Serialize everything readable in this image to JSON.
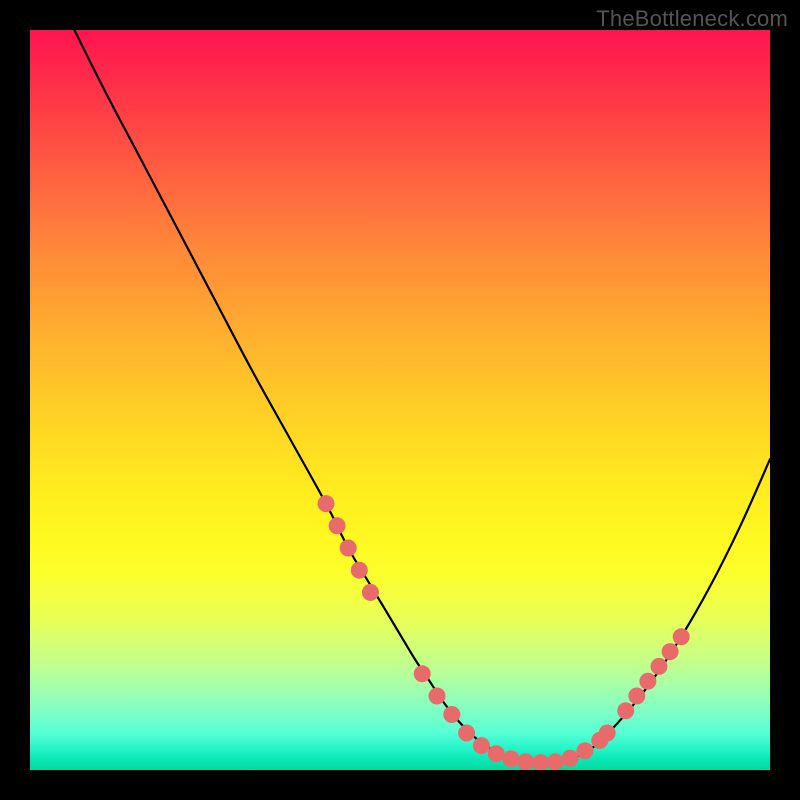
{
  "watermark": "TheBottleneck.com",
  "chart_data": {
    "type": "line",
    "title": "",
    "xlabel": "",
    "ylabel": "",
    "xlim": [
      0,
      100
    ],
    "ylim": [
      0,
      100
    ],
    "series": [
      {
        "name": "curve",
        "x": [
          6,
          10,
          15,
          20,
          25,
          30,
          35,
          40,
          43,
          46,
          49,
          52,
          54,
          56,
          58,
          60,
          62,
          64,
          66,
          68,
          70,
          73,
          76,
          80,
          84,
          88,
          92,
          96,
          100
        ],
        "values": [
          100,
          92,
          82.5,
          73,
          63.5,
          54,
          45,
          36,
          30,
          25,
          20,
          15,
          12,
          9,
          6.5,
          4.5,
          3,
          2,
          1.3,
          1,
          1,
          1.5,
          3,
          7,
          12,
          18,
          25,
          33,
          42
        ]
      }
    ],
    "markers": {
      "name": "highlight-dots",
      "color": "#e86a6a",
      "points": [
        {
          "x": 40,
          "y": 36
        },
        {
          "x": 41.5,
          "y": 33
        },
        {
          "x": 43,
          "y": 30
        },
        {
          "x": 44.5,
          "y": 27
        },
        {
          "x": 46,
          "y": 24
        },
        {
          "x": 53,
          "y": 13
        },
        {
          "x": 55,
          "y": 10
        },
        {
          "x": 57,
          "y": 7.5
        },
        {
          "x": 59,
          "y": 5
        },
        {
          "x": 61,
          "y": 3.3
        },
        {
          "x": 63,
          "y": 2.2
        },
        {
          "x": 65,
          "y": 1.5
        },
        {
          "x": 67,
          "y": 1.1
        },
        {
          "x": 69,
          "y": 1
        },
        {
          "x": 71,
          "y": 1.1
        },
        {
          "x": 73,
          "y": 1.6
        },
        {
          "x": 75,
          "y": 2.6
        },
        {
          "x": 77,
          "y": 4
        },
        {
          "x": 78,
          "y": 5
        },
        {
          "x": 80.5,
          "y": 8
        },
        {
          "x": 82,
          "y": 10
        },
        {
          "x": 83.5,
          "y": 12
        },
        {
          "x": 85,
          "y": 14
        },
        {
          "x": 86.5,
          "y": 16
        },
        {
          "x": 88,
          "y": 18
        }
      ]
    }
  }
}
